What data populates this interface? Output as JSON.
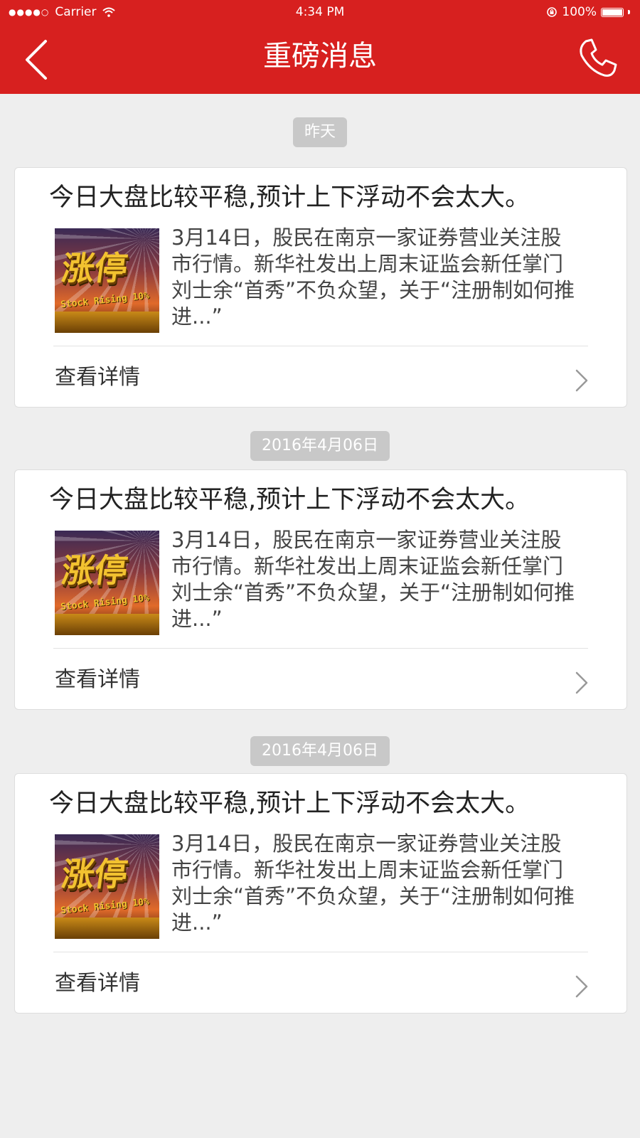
{
  "status_bar": {
    "signal": "●●●●○",
    "carrier": "Carrier",
    "time": "4:34 PM",
    "battery": "100%"
  },
  "header": {
    "title": "重磅消息",
    "back_icon": "chevron-left-icon",
    "phone_icon": "phone-icon"
  },
  "colors": {
    "brand_red": "#d7201f",
    "background": "#eeeeee",
    "badge_gray": "#c8c8c8"
  },
  "messages": [
    {
      "date": "昨天",
      "title": "今日大盘比较平稳,预计上下浮动不会太大。",
      "thumbnail": {
        "main": "涨停",
        "sub": "Stock Rising 10%"
      },
      "description": "3月14日，股民在南京一家证券营业关注股市行情。新华社发出上周末证监会新任掌门刘士余“首秀”不负众望，关于“注册制如何推进...”",
      "action_label": "查看详情"
    },
    {
      "date": "2016年4月06日",
      "title": "今日大盘比较平稳,预计上下浮动不会太大。",
      "thumbnail": {
        "main": "涨停",
        "sub": "Stock Rising 10%"
      },
      "description": "3月14日，股民在南京一家证券营业关注股市行情。新华社发出上周末证监会新任掌门刘士余“首秀”不负众望，关于“注册制如何推进...”",
      "action_label": "查看详情"
    },
    {
      "date": "2016年4月06日",
      "title": "今日大盘比较平稳,预计上下浮动不会太大。",
      "thumbnail": {
        "main": "涨停",
        "sub": "Stock Rising 10%"
      },
      "description": "3月14日，股民在南京一家证券营业关注股市行情。新华社发出上周末证监会新任掌门刘士余“首秀”不负众望，关于“注册制如何推进...”",
      "action_label": "查看详情"
    }
  ]
}
